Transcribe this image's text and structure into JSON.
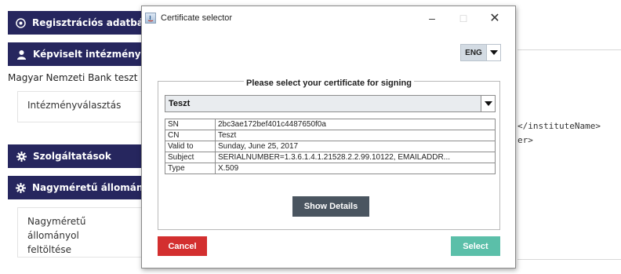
{
  "background": {
    "nav": [
      {
        "label": "Regisztrációs adatbázi",
        "icon": "circle-arrow-icon"
      },
      {
        "label": "Képviselt intézmény",
        "icon": "user-icon"
      },
      {
        "label": "Szolgáltatások",
        "icon": "gear-icon"
      },
      {
        "label": "Nagyméretű állományo",
        "icon": "gear-icon"
      }
    ],
    "bank_label": "Magyar Nemzeti Bank teszt",
    "institution_box": "Intézményválasztás",
    "upload_box_line1": "Nagyméretű állományol",
    "upload_box_line2": "feltöltése",
    "code_line1": "</instituteName>",
    "code_line2": "er>"
  },
  "dialog": {
    "title": "Certificate selector",
    "window_min": "–",
    "window_max": "□",
    "window_close": "✕",
    "language": "ENG",
    "group_title": "Please select your certificate for signing",
    "selected_certificate": "Teszt",
    "details": [
      {
        "key": "SN",
        "value": "2bc3ae172bef401c4487650f0a"
      },
      {
        "key": "CN",
        "value": "Teszt"
      },
      {
        "key": "Valid to",
        "value": "Sunday, June 25, 2017"
      },
      {
        "key": "Subject",
        "value": "SERIALNUMBER=1.3.6.1.4.1.21528.2.2.99.10122, EMAILADDR..."
      },
      {
        "key": "Type",
        "value": "X.509"
      }
    ],
    "show_details_label": "Show Details",
    "cancel_label": "Cancel",
    "select_label": "Select",
    "colors": {
      "nav_bg": "#26265e",
      "cancel": "#d32f2f",
      "select": "#5bbfa9",
      "show_details": "#4a5560"
    }
  }
}
